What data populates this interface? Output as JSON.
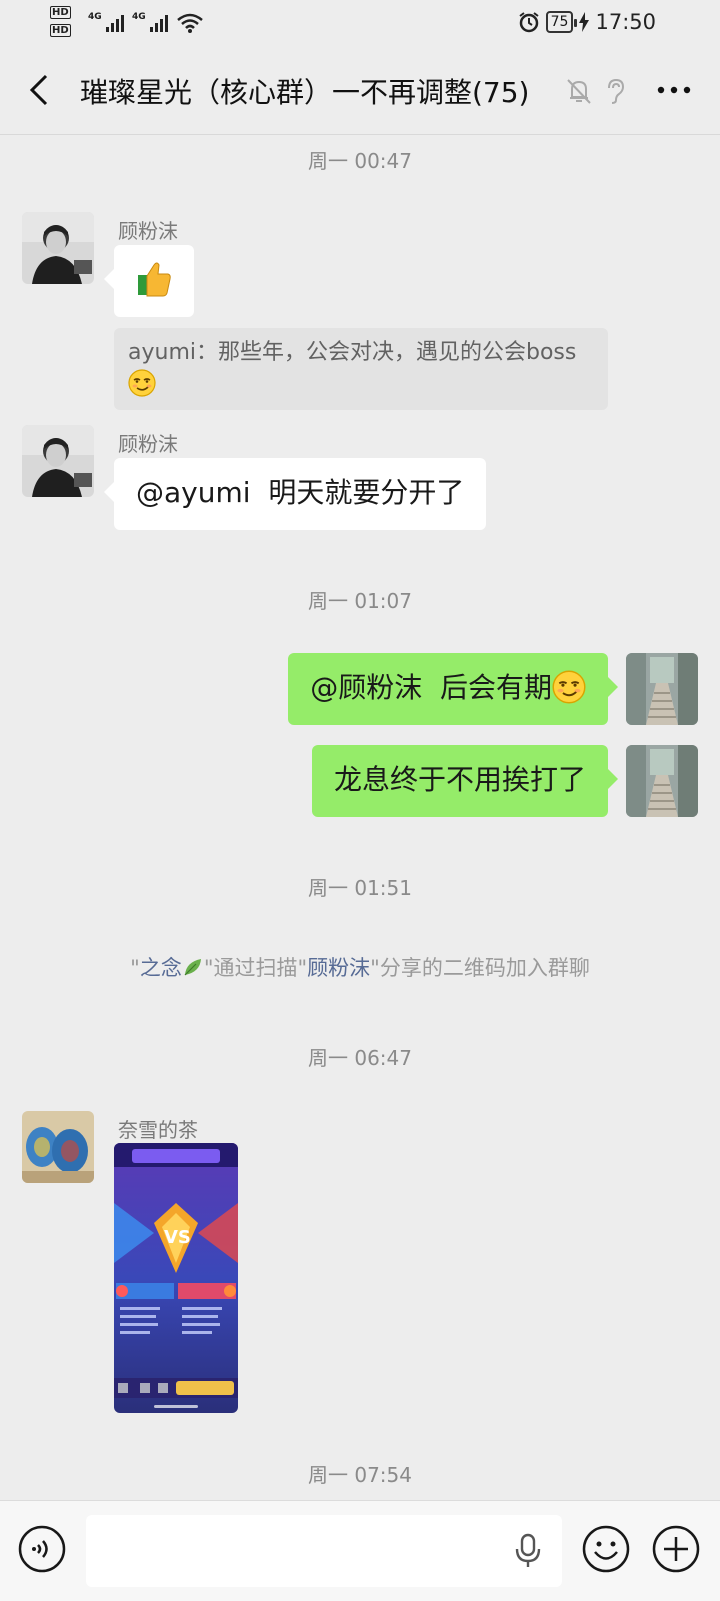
{
  "status_bar": {
    "hd1": "HD",
    "hd2": "HD",
    "net1": "4G",
    "net2": "4G",
    "battery": "75",
    "time": "17:50"
  },
  "header": {
    "title": "璀璨星光（核心群）一不再调整(75)"
  },
  "messages": {
    "time1": "周一 00:47",
    "m1_sender": "顾粉沫",
    "quote_text": "ayumi：那些年，公会对决，遇见的公会boss",
    "m2_sender": "顾粉沫",
    "m2_text": "@ayumi  明天就要分开了",
    "time2": "周一 01:07",
    "m3_text": "@顾粉沫  后会有期",
    "m4_text": "龙息终于不用挨打了",
    "time3": "周一 01:51",
    "sys_q1": "\"",
    "sys_name1": "之念",
    "sys_mid": "\"通过扫描\"",
    "sys_name2": "顾粉沫",
    "sys_end": "\"分享的二维码加入群聊",
    "time4": "周一 06:47",
    "m5_sender": "奈雪的茶",
    "time5_partial": "周一 07:54"
  },
  "input": {
    "placeholder": ""
  },
  "colors": {
    "background": "#ededed",
    "self_bubble": "#95ec69",
    "other_bubble": "#ffffff",
    "link_name": "#576b95"
  },
  "icons": [
    "back-icon",
    "mute-bell-icon",
    "ear-icon",
    "more-icon",
    "voice-icon",
    "microphone-icon",
    "emoji-icon",
    "plus-icon"
  ]
}
